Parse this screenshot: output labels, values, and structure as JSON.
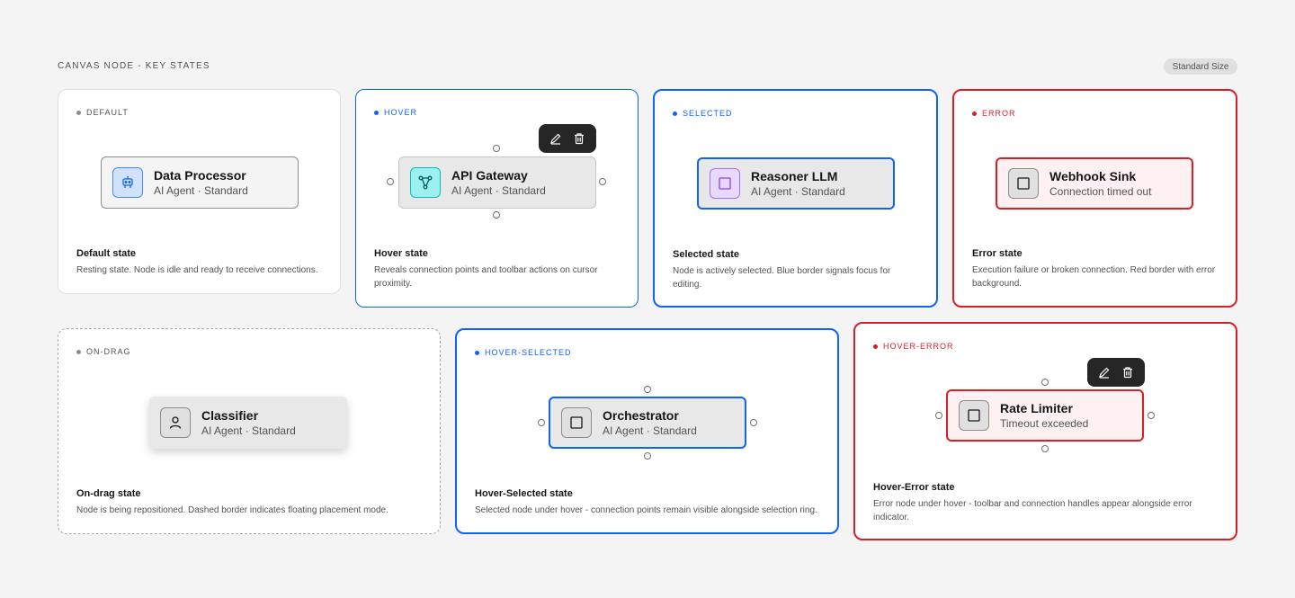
{
  "header": {
    "title": "CANVAS NODE - KEY STATES",
    "badge": "Standard Size"
  },
  "cards": {
    "default": {
      "tag": "DEFAULT",
      "node_name": "Data Processor",
      "node_sub": "AI Agent · Standard",
      "title": "Default state",
      "desc": "Resting state. Node is idle and ready to receive connections."
    },
    "hover": {
      "tag": "HOVER",
      "node_name": "API Gateway",
      "node_sub": "AI Agent · Standard",
      "title": "Hover state",
      "desc": "Reveals connection points and toolbar actions on cursor proximity."
    },
    "selected": {
      "tag": "SELECTED",
      "node_name": "Reasoner LLM",
      "node_sub": "AI Agent · Standard",
      "title": "Selected state",
      "desc": "Node is actively selected. Blue border signals focus for editing."
    },
    "error": {
      "tag": "ERROR",
      "node_name": "Webhook Sink",
      "node_sub": "Connection timed out",
      "title": "Error state",
      "desc": "Execution failure or broken connection. Red border with error background."
    },
    "ondrag": {
      "tag": "ON-DRAG",
      "node_name": "Classifier",
      "node_sub": "AI Agent · Standard",
      "title": "On-drag state",
      "desc": "Node is being repositioned. Dashed border indicates floating placement mode."
    },
    "hover_selected": {
      "tag": "HOVER-SELECTED",
      "node_name": "Orchestrator",
      "node_sub": "AI Agent · Standard",
      "title": "Hover-Selected state",
      "desc": "Selected node under hover - connection points remain visible alongside selection ring."
    },
    "hover_error": {
      "tag": "HOVER-ERROR",
      "node_name": "Rate Limiter",
      "node_sub": "Timeout exceeded",
      "title": "Hover-Error state",
      "desc": "Error node under hover - toolbar and connection handles appear alongside error indicator."
    }
  },
  "icons": {
    "default_node": "robot-icon",
    "hover_node": "network-icon",
    "selected_node": "square-icon",
    "error_node": "square-icon",
    "ondrag_node": "user-icon",
    "hover_selected_node": "square-icon",
    "hover_error_node": "square-icon",
    "toolbar_edit": "pencil-icon",
    "toolbar_delete": "trash-icon"
  },
  "colors": {
    "selection": "#0f62fe",
    "error": "#da1e28",
    "error_bg": "#fff1f1",
    "toolbar": "#262626"
  }
}
